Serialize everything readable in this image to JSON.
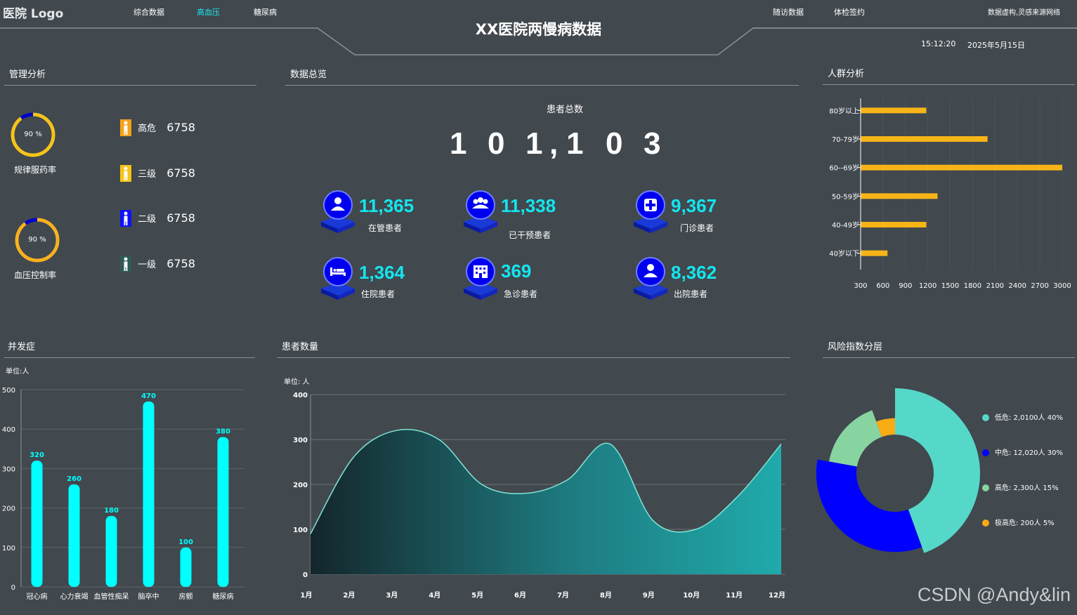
{
  "header": {
    "logo": "医院 Logo",
    "title": "XX医院两慢病数据",
    "nav_left": [
      "综合数据",
      "高血压",
      "糖尿病"
    ],
    "nav_right": [
      "随访数据",
      "体检签约"
    ],
    "disclaimer": "数据虚构,灵感来源网络",
    "time": "15:12:20",
    "date": "2025年5月15日"
  },
  "panels": {
    "management": "管理分析",
    "overview": "数据总览",
    "population": "人群分析",
    "complications": "并发症",
    "patients": "患者数量",
    "risk": "风险指数分层"
  },
  "management": {
    "gauges": [
      {
        "label": "规律服药率",
        "value_text": "90",
        "pct_sign": "%",
        "percent": 90
      },
      {
        "label": "血压控制率",
        "value_text": "90",
        "pct_sign": "%",
        "percent": 90
      }
    ],
    "levels": [
      {
        "label": "高危",
        "value": "6758",
        "color": "#f7a21b"
      },
      {
        "label": "三级",
        "value": "6758",
        "color": "#f5c518"
      },
      {
        "label": "二级",
        "value": "6758",
        "color": "#1010ff"
      },
      {
        "label": "一级",
        "value": "6758",
        "color": "#2f5a55"
      }
    ]
  },
  "overview": {
    "total_label": "患者总数",
    "total_digits": [
      "1",
      "0",
      "1",
      ",",
      "1",
      "0",
      "3"
    ],
    "stats": [
      {
        "value": "11,365",
        "label": "在管患者",
        "icon": "user-icon"
      },
      {
        "value": "11,338",
        "label": "已干预患者",
        "icon": "group-icon"
      },
      {
        "value": "9,367",
        "label": "门诊患者",
        "icon": "medical-cross-icon"
      },
      {
        "value": "1,364",
        "label": "住院患者",
        "icon": "bed-icon"
      },
      {
        "value": "369",
        "label": "急诊患者",
        "icon": "building-icon"
      },
      {
        "value": "8,362",
        "label": "出院患者",
        "icon": "user-icon"
      }
    ]
  },
  "complications": {
    "unit": "单位:人"
  },
  "patients": {
    "unit": "单位:  人"
  },
  "risk": {
    "legend": [
      {
        "text": "低危: 2,0100人  40%",
        "color": "#56d8c9"
      },
      {
        "text": "中危: 12,020人  30%",
        "color": "#0000ff"
      },
      {
        "text": "高危: 2,300人  15%",
        "color": "#88d4a0"
      },
      {
        "text": "极高危: 200人  5%",
        "color": "#f8ab13"
      }
    ]
  },
  "watermark": "CSDN @Andy&lin",
  "chart_data": [
    {
      "type": "bar",
      "orientation": "horizontal",
      "categories": [
        "80岁以上",
        "70-79岁",
        "60--69岁",
        "50-59岁",
        "40-49岁",
        "40岁以下"
      ],
      "values": [
        1180,
        2000,
        3000,
        1330,
        1180,
        660
      ],
      "xlim": [
        300,
        3000
      ],
      "xticks": [
        300,
        600,
        900,
        1200,
        1500,
        1800,
        2100,
        2400,
        2700,
        3000
      ],
      "color": "#f8b417"
    },
    {
      "type": "bar",
      "categories": [
        "冠心病",
        "心力衰竭",
        "血管性痴呆",
        "脑卒中",
        "房颤",
        "糖尿病"
      ],
      "values": [
        320,
        260,
        180,
        470,
        100,
        380
      ],
      "ylim": [
        0,
        500
      ],
      "yticks": [
        0,
        100,
        200,
        300,
        400,
        500
      ],
      "color": "#00ffff"
    },
    {
      "type": "area",
      "categories": [
        "1月",
        "2月",
        "3月",
        "4月",
        "5月",
        "6月",
        "7月",
        "8月",
        "9月",
        "10月",
        "11月",
        "12月"
      ],
      "values": [
        90,
        260,
        320,
        300,
        200,
        180,
        210,
        290,
        120,
        100,
        175,
        290
      ],
      "ylim": [
        0,
        400
      ],
      "yticks": [
        0,
        100,
        200,
        300,
        400
      ]
    },
    {
      "type": "pie",
      "style": "rose-donut",
      "labels": [
        "低危",
        "中危",
        "高危",
        "极高危"
      ],
      "values": [
        40,
        30,
        15,
        5
      ],
      "colors": [
        "#56d8c9",
        "#0000ff",
        "#88d4a0",
        "#f8ab13"
      ]
    }
  ]
}
